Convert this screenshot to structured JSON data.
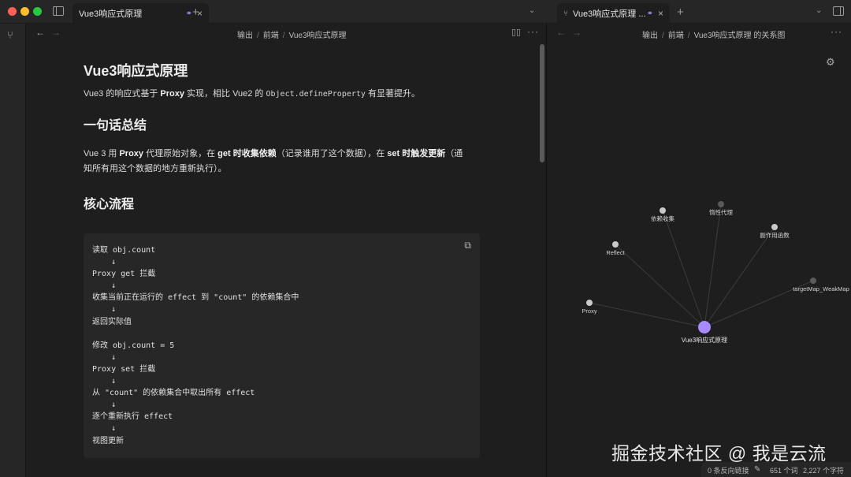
{
  "tabs": {
    "left_title": "Vue3响应式原理",
    "right_title": "Vue3响应式原理 ...",
    "new_tab": "+",
    "close": "×",
    "link_icon": "link-icon",
    "graph_icon": "graph-icon"
  },
  "left_pane": {
    "breadcrumb": [
      "输出",
      "前端",
      "Vue3响应式原理"
    ],
    "breadcrumb_sep": "/"
  },
  "right_pane": {
    "breadcrumb": [
      "输出",
      "前端",
      "Vue3响应式原理 的关系图"
    ],
    "breadcrumb_sep": "/"
  },
  "doc": {
    "title": "Vue3响应式原理",
    "intro_pre": "Vue3 的响应式基于 ",
    "intro_bold": "Proxy",
    "intro_mid": " 实现，相比 Vue2 的 ",
    "intro_code": "Object.defineProperty",
    "intro_post": " 有显著提升。",
    "h2_summary": "一句话总结",
    "summary_p1": "Vue 3 用 ",
    "summary_b1": "Proxy",
    "summary_p2": " 代理原始对象，在 ",
    "summary_b2": "get 时收集依赖",
    "summary_p3": "（记录谁用了这个数据），在 ",
    "summary_b3": "set 时触发更新",
    "summary_p4": "（通",
    "summary_line2": "知所有用这个数据的地方重新执行）。",
    "h2_flow": "核心流程",
    "code_lines": [
      "读取 obj.count",
      "    ↓",
      "Proxy get 拦截",
      "    ↓",
      "收集当前正在运行的 effect 到 \"count\" 的依赖集合中",
      "    ↓",
      "返回实际值",
      "",
      "修改 obj.count = 5",
      "    ↓",
      "Proxy set 拦截",
      "    ↓",
      "从 \"count\" 的依赖集合中取出所有 effect",
      "    ↓",
      "逐个重新执行 effect",
      "    ↓",
      "视图更新"
    ]
  },
  "graph": {
    "center_label": "Vue3响应式原理",
    "accent_color": "#a78bfa",
    "nodes": [
      {
        "label": "依赖收集",
        "resolved": true
      },
      {
        "label": "惰性代理",
        "resolved": false
      },
      {
        "label": "副作用函数",
        "resolved": true
      },
      {
        "label": "Reflect",
        "resolved": true
      },
      {
        "label": "targetMap_WeakMap",
        "resolved": false
      },
      {
        "label": "Proxy",
        "resolved": true
      }
    ]
  },
  "watermark": "掘金技术社区 @ 我是云流",
  "status": {
    "backlinks": "0 条反向链接",
    "words": "651 个词",
    "chars": "2,227 个字符"
  }
}
